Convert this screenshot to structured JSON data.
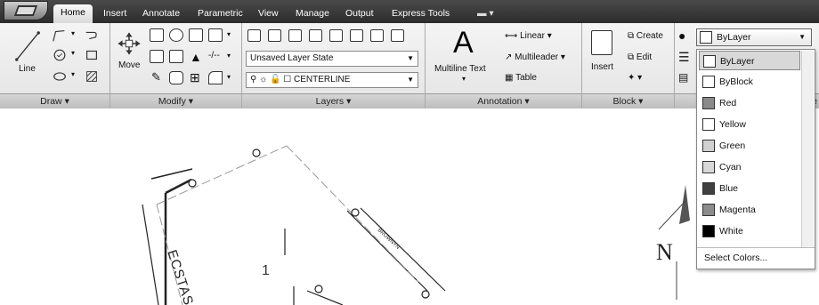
{
  "tabs": [
    "Home",
    "Insert",
    "Annotate",
    "Parametric",
    "View",
    "Manage",
    "Output",
    "Express Tools"
  ],
  "active_tab": "Home",
  "panels": {
    "draw": {
      "title": "Draw",
      "line_label": "Line"
    },
    "modify": {
      "title": "Modify",
      "move_label": "Move"
    },
    "layers": {
      "title": "Layers",
      "state_value": "Unsaved Layer State",
      "layer_value": "CENTERLINE"
    },
    "annotation": {
      "title": "Annotation",
      "multiline_label": "Multiline Text",
      "linear": "Linear",
      "multileader": "Multileader",
      "table": "Table"
    },
    "block": {
      "title": "Block",
      "insert": "Insert",
      "create": "Create",
      "edit": "Edit"
    },
    "properties": {
      "partial_title": "ie"
    }
  },
  "color_combo": {
    "selected": "ByLayer"
  },
  "color_dropdown": {
    "options": [
      {
        "label": "ByLayer",
        "color": "#ffffff"
      },
      {
        "label": "ByBlock",
        "color": "#ffffff"
      },
      {
        "label": "Red",
        "color": "#8a8a8a"
      },
      {
        "label": "Yellow",
        "color": "#ffffff"
      },
      {
        "label": "Green",
        "color": "#d0d0d0"
      },
      {
        "label": "Cyan",
        "color": "#d8d8d8"
      },
      {
        "label": "Blue",
        "color": "#404040"
      },
      {
        "label": "Magenta",
        "color": "#8c8c8c"
      },
      {
        "label": "White",
        "color": "#000000"
      }
    ],
    "footer": "Select Colors..."
  },
  "drawing": {
    "parcel_number": "1",
    "street_1": "ECSTAS",
    "street_2": "BROWNYN",
    "compass_letter": "N"
  }
}
